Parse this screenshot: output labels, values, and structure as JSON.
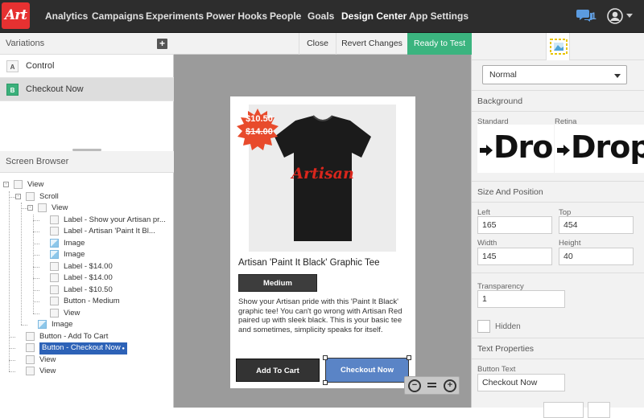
{
  "app": {
    "logo_text": "Art",
    "nav": [
      "Analytics",
      "Campaigns",
      "Experiments",
      "Power Hooks",
      "People",
      "Goals",
      "Design Center",
      "App Settings"
    ],
    "active_nav": "Design Center",
    "messages_count": "1",
    "accent_color": "#3bb47f",
    "brand_color": "#e63131"
  },
  "variations": {
    "header": "Variations",
    "items": [
      {
        "badge": "A",
        "name": "Control"
      },
      {
        "badge": "B",
        "name": "Checkout Now"
      }
    ]
  },
  "screen_browser": {
    "header": "Screen Browser",
    "nodes": [
      {
        "label": "View",
        "depth": 0,
        "toggle": "-",
        "icon": "view-icon"
      },
      {
        "label": "Scroll",
        "depth": 1,
        "toggle": "-",
        "icon": "scroll-icon"
      },
      {
        "label": "View",
        "depth": 2,
        "toggle": "-",
        "icon": "view-icon"
      },
      {
        "label": "Label - Show your Artisan pr...",
        "depth": 3,
        "icon": "label-icon"
      },
      {
        "label": "Label - Artisan 'Paint It Bl...",
        "depth": 3,
        "icon": "label-icon"
      },
      {
        "label": "Image",
        "depth": 3,
        "icon": "image-icon"
      },
      {
        "label": "Image",
        "depth": 3,
        "icon": "image-icon"
      },
      {
        "label": "Label - $14.00",
        "depth": 3,
        "icon": "label-icon"
      },
      {
        "label": "Label - $14.00",
        "depth": 3,
        "icon": "label-icon"
      },
      {
        "label": "Label - $10.50",
        "depth": 3,
        "icon": "label-icon"
      },
      {
        "label": "Button - Medium",
        "depth": 3,
        "icon": "button-icon"
      },
      {
        "label": "View",
        "depth": 3,
        "icon": "view-icon"
      },
      {
        "label": "Image",
        "depth": 2,
        "icon": "image-icon"
      },
      {
        "label": "Button - Add To Cart",
        "depth": 1,
        "icon": "button-icon"
      },
      {
        "label": "Button - Checkout Now",
        "depth": 1,
        "icon": "button-icon",
        "selected": true
      },
      {
        "label": "View",
        "depth": 1,
        "icon": "view-icon"
      },
      {
        "label": "View",
        "depth": 1,
        "icon": "view-icon"
      }
    ]
  },
  "toolbar": {
    "close_label": "Close",
    "revert_label": "Revert Changes",
    "ready_label": "Ready to Test"
  },
  "preview": {
    "price_now": "$10.50",
    "price_old": "$14.00",
    "shirt_brand": "Artisan",
    "product_title": "Artisan 'Paint It Black' Graphic Tee",
    "size_button": "Medium",
    "description": "Show your Artisan pride with this 'Paint It Black' graphic tee! You can't go wrong with Artisan Red paired up with sleek black. This is your basic tee and sometimes, simplicity speaks for itself.",
    "add_to_cart": "Add To Cart",
    "checkout": "Checkout Now"
  },
  "properties": {
    "state_value": "Normal",
    "background_header": "Background",
    "standard_label": "Standard",
    "retina_label": "Retina",
    "drop_text": "Drop",
    "size_position_header": "Size And Position",
    "left_label": "Left",
    "left_value": "165",
    "top_label": "Top",
    "top_value": "454",
    "width_label": "Width",
    "width_value": "145",
    "height_label": "Height",
    "height_value": "40",
    "transparency_label": "Transparency",
    "transparency_value": "1",
    "hidden_label": "Hidden",
    "text_properties_header": "Text Properties",
    "button_text_label": "Button Text",
    "button_text_value": "Checkout Now"
  }
}
